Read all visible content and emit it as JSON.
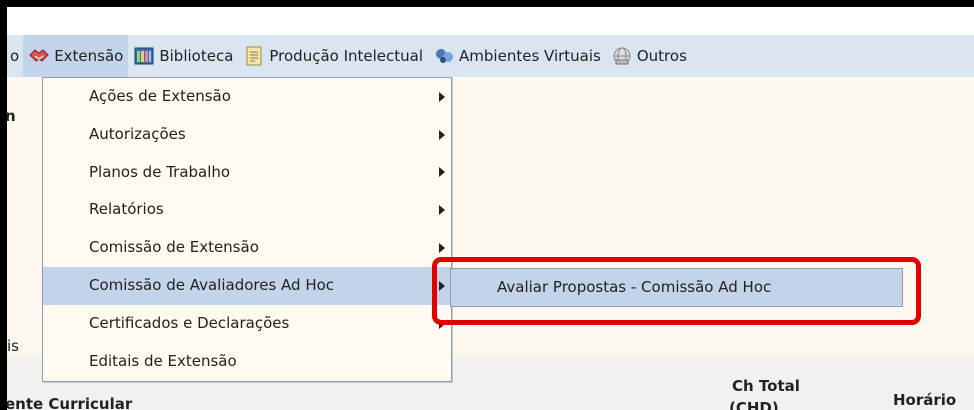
{
  "menubar": {
    "items": [
      {
        "label": "o",
        "icon": "none"
      },
      {
        "label": "Extensão",
        "icon": "handshake-icon"
      },
      {
        "label": "Biblioteca",
        "icon": "bookshelf-icon"
      },
      {
        "label": "Produção Intelectual",
        "icon": "document-icon"
      },
      {
        "label": "Ambientes Virtuais",
        "icon": "virtual-environment-icon"
      },
      {
        "label": "Outros",
        "icon": "globe-icon"
      }
    ]
  },
  "dropdown": {
    "items": [
      {
        "label": "Ações de Extensão",
        "has_submenu": true
      },
      {
        "label": "Autorizações",
        "has_submenu": true
      },
      {
        "label": "Planos de Trabalho",
        "has_submenu": true
      },
      {
        "label": "Relatórios",
        "has_submenu": true
      },
      {
        "label": "Comissão de Extensão",
        "has_submenu": true
      },
      {
        "label": "Comissão de Avaliadores Ad Hoc",
        "has_submenu": true
      },
      {
        "label": "Certificados e Declarações",
        "has_submenu": true
      },
      {
        "label": "Editais de Extensão",
        "has_submenu": false
      }
    ]
  },
  "submenu": {
    "items": [
      {
        "label": "Avaliar Propostas - Comissão Ad Hoc"
      }
    ]
  },
  "background": {
    "partial_left_1": "n",
    "partial_left_2": "is",
    "table_col_1": "ente Curricular",
    "table_col_2": "Ch Total",
    "table_col_2_sub": "(CHD)",
    "table_col_3": "Horário"
  },
  "colors": {
    "menubar": "#dbe5f1",
    "highlight": "#c3d3ea",
    "annotation": "#e00000"
  }
}
